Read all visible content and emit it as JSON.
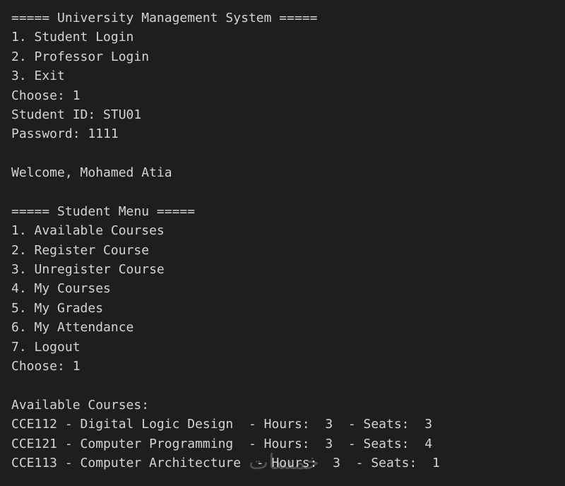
{
  "terminal": {
    "lines": [
      "===== University Management System =====",
      "1. Student Login",
      "2. Professor Login",
      "3. Exit",
      "Choose: 1",
      "Student ID: STU01",
      "Password: 1111",
      "",
      "Welcome, Mohamed Atia",
      "",
      "===== Student Menu =====",
      "1. Available Courses",
      "2. Register Course",
      "3. Unregister Course",
      "4. My Courses",
      "5. My Grades",
      "6. My Attendance",
      "7. Logout",
      "Choose: 1",
      "",
      "Available Courses:",
      "CCE112 - Digital Logic Design  - Hours:  3  - Seats:  3",
      "CCE121 - Computer Programming  - Hours:  3  - Seats:  4",
      "CCE113 - Computer Architecture  - Hours:  3  - Seats:  1"
    ],
    "watermark": "خمسات"
  },
  "colors": {
    "background": "#1e1e1e",
    "text": "#d4d4d4"
  }
}
